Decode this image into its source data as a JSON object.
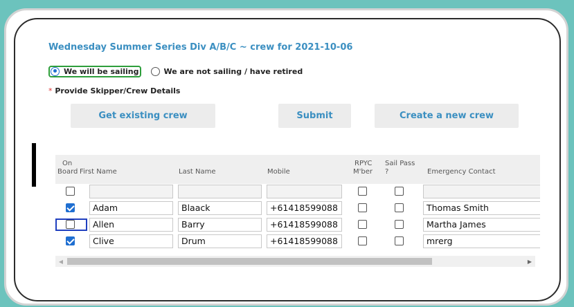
{
  "form": {
    "title": "Wednesday Summer Series Div A/B/C ~ crew for 2021-10-06",
    "sailing_option": "We will be sailing",
    "not_sailing_option": "We are not sailing / have retired",
    "selected_option": "sailing",
    "required_star": "*",
    "required_note": "Provide Skipper/Crew Details"
  },
  "buttons": {
    "get_existing": "Get existing crew",
    "submit": "Submit",
    "create_new": "Create a new crew"
  },
  "table": {
    "headers": {
      "on_board_1": "On",
      "on_board_2": "Board",
      "first_name": "First Name",
      "last_name": "Last Name",
      "mobile": "Mobile",
      "rpyc_1": "RPYC",
      "rpyc_2": "M'ber",
      "sail_pass_1": "Sail Pass",
      "sail_pass_2": "?",
      "emergency": "Emergency Contact"
    },
    "rows": [
      {
        "on_board": false,
        "first_name": "",
        "last_name": "",
        "mobile": "",
        "rpyc": false,
        "sail_pass": false,
        "emergency": ""
      },
      {
        "on_board": true,
        "first_name": "Adam",
        "last_name": "Blaack",
        "mobile": "+61418599088",
        "rpyc": false,
        "sail_pass": false,
        "emergency": "Thomas Smith"
      },
      {
        "on_board": false,
        "first_name": "Allen",
        "last_name": "Barry",
        "mobile": "+61418599088",
        "rpyc": false,
        "sail_pass": false,
        "emergency": "Martha James"
      },
      {
        "on_board": true,
        "first_name": "Clive",
        "last_name": "Drum",
        "mobile": "+61418599088",
        "rpyc": false,
        "sail_pass": false,
        "emergency": "mrerg"
      }
    ]
  },
  "scrollbar": {
    "left_arrow": "◀",
    "right_arrow": "▶"
  },
  "colors": {
    "background": "#6cc3bd",
    "accent": "#3b8fc1",
    "checkbox_checked": "#1f6fd1",
    "selected_outline": "#2d9e3b"
  }
}
